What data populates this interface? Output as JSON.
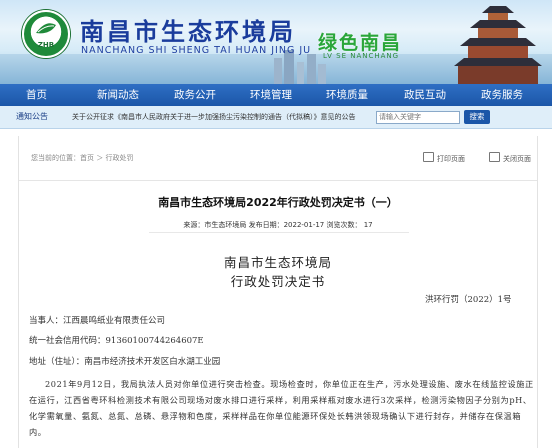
{
  "header": {
    "logo_text": "ZHB",
    "title": "南昌市生态环境局",
    "pinyin": "NANCHANG SHI SHENG TAI HUAN JING JU",
    "slogan": "绿色南昌",
    "slogan_en": "LV SE NANCHANG"
  },
  "nav": {
    "items": [
      "首页",
      "新闻动态",
      "政务公开",
      "环境管理",
      "环境质量",
      "政民互动",
      "政务服务"
    ]
  },
  "notice": {
    "label": "通知公告",
    "text": "关于公开征求《南昌市人民政府关于进一步加强扬尘污染控制的通告（代拟稿）》意见的公告",
    "search_placeholder": "请输入关键字",
    "search_button": "搜索"
  },
  "content": {
    "breadcrumb": "您当前的位置：首页 ＞ 行政处罚",
    "print_label": "打印页面",
    "close_label": "关闭页面",
    "article_title": "南昌市生态环境局2022年行政处罚决定书（一）",
    "meta": "来源：市生态环境局   发布日期：2022-01-17   浏览次数： 17",
    "doc_org": "南昌市生态环境局",
    "doc_type": "行政处罚决定书",
    "doc_no": "洪环行罚（2022）1号",
    "party": "当事人：江西晨鸣纸业有限责任公司",
    "credit_code": "统一社会信用代码：91360100744264607E",
    "address": "地址（住址）：南昌市经济技术开发区白水湖工业园",
    "body_paragraph": "2021年9月12日，我局执法人员对你单位进行突击检查。现场检查时，你单位正在生产，污水处理设施、废水在线监控设施正在运行，江西省粤环科检测技术有限公司现场对废水排口进行采样，利用采样瓶对废水进行3次采样，检测污染物因子分别为pH、化学需氧量、氨氮、总氮、总磷、悬浮物和色度，采样样品在你单位能源环保处长韩洪领现场确认下进行封存，并储存在保温箱内。"
  },
  "colors": {
    "nav_bg": "#1b56a8",
    "title_blue": "#1a3c9c",
    "slogan_green": "#2aa63a",
    "notice_bg": "#dfeef9"
  }
}
